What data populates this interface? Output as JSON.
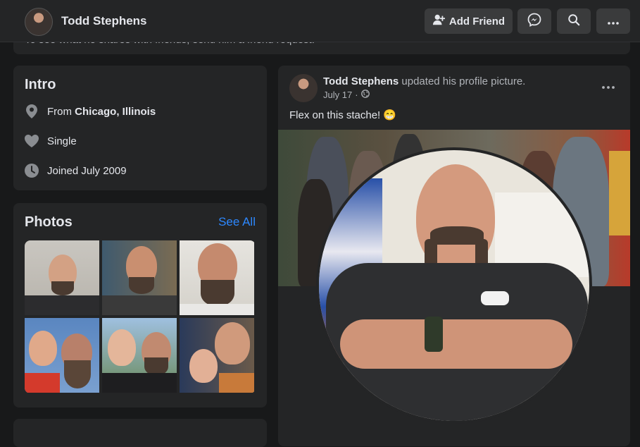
{
  "topbar": {
    "name": "Todd Stephens",
    "add_friend_label": "Add Friend"
  },
  "notice": {
    "text": "To see what he shares with friends, send him a friend request."
  },
  "intro": {
    "title": "Intro",
    "from_prefix": "From ",
    "from_place": "Chicago, Illinois",
    "relationship": "Single",
    "joined": "Joined July 2009"
  },
  "photos": {
    "title": "Photos",
    "see_all": "See All"
  },
  "post": {
    "author": "Todd Stephens",
    "action": " updated his profile picture.",
    "date": "July 17",
    "date_sep": "·",
    "text": "Flex on this stache! 😁"
  },
  "icons": {
    "add_friend": "person-plus-icon",
    "messenger": "messenger-icon",
    "search": "search-icon",
    "more": "ellipsis-icon",
    "location": "location-pin-icon",
    "relationship": "heart-icon",
    "joined": "clock-icon",
    "audience": "globe-icon"
  },
  "colors": {
    "background": "#18191a",
    "card": "#242526",
    "button": "#3a3b3c",
    "link": "#2d88ff",
    "text_primary": "#e4e6eb",
    "text_secondary": "#b0b3b8"
  }
}
